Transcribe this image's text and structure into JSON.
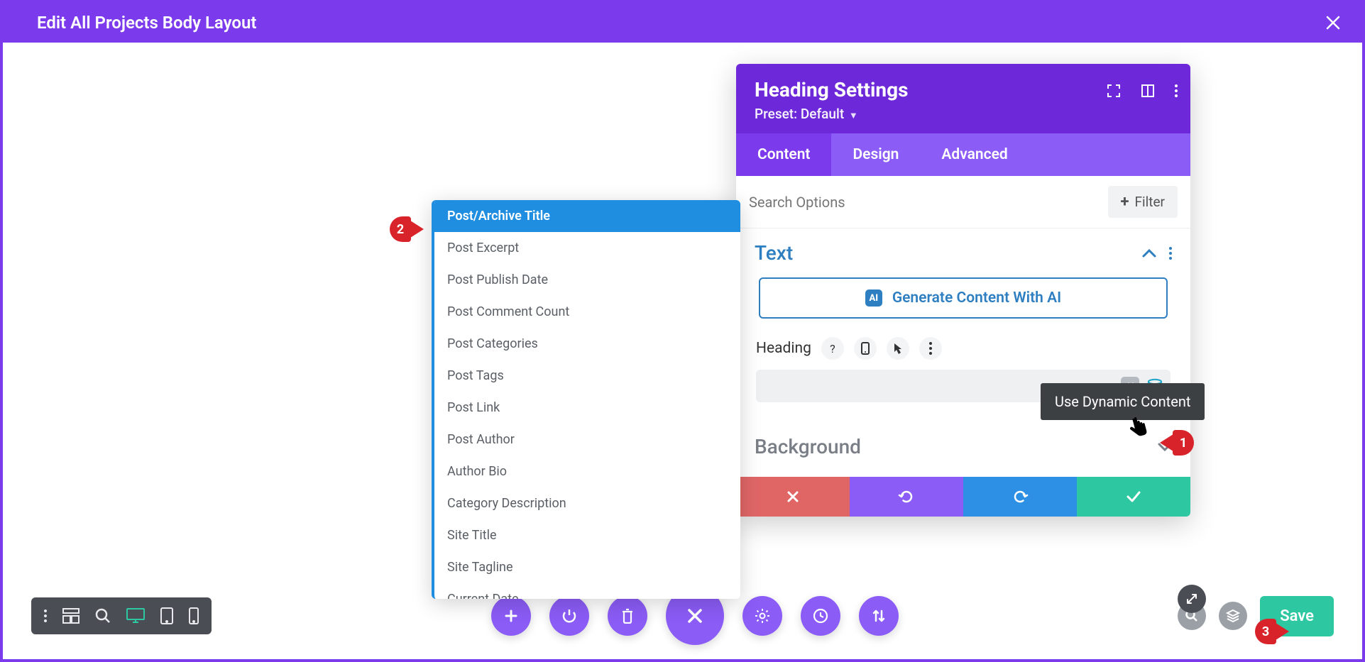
{
  "top": {
    "title": "Edit All Projects Body Layout"
  },
  "panel": {
    "title": "Heading Settings",
    "preset_label": "Preset:",
    "preset_value": "Default",
    "tabs": [
      "Content",
      "Design",
      "Advanced"
    ],
    "active_tab": 0,
    "search_placeholder": "Search Options",
    "filter_label": "Filter",
    "text_section": "Text",
    "ai_button": "Generate Content With AI",
    "heading_label": "Heading",
    "background_section": "Background"
  },
  "tooltip": {
    "text": "Use Dynamic Content"
  },
  "dynamic_list": {
    "items": [
      "Post/Archive Title",
      "Post Excerpt",
      "Post Publish Date",
      "Post Comment Count",
      "Post Categories",
      "Post Tags",
      "Post Link",
      "Post Author",
      "Author Bio",
      "Category Description",
      "Site Title",
      "Site Tagline",
      "Current Date"
    ],
    "selected_index": 0
  },
  "callouts": {
    "one": "1",
    "two": "2",
    "three": "3"
  },
  "bottom": {
    "save": "Save"
  },
  "colors": {
    "purple": "#7c3aed",
    "purple_light": "#8b5cf6",
    "blue": "#2e7fc1",
    "teal": "#2dc7a1",
    "red": "#e06666",
    "blue2": "#2e90e5",
    "callout_red": "#d8232a"
  }
}
